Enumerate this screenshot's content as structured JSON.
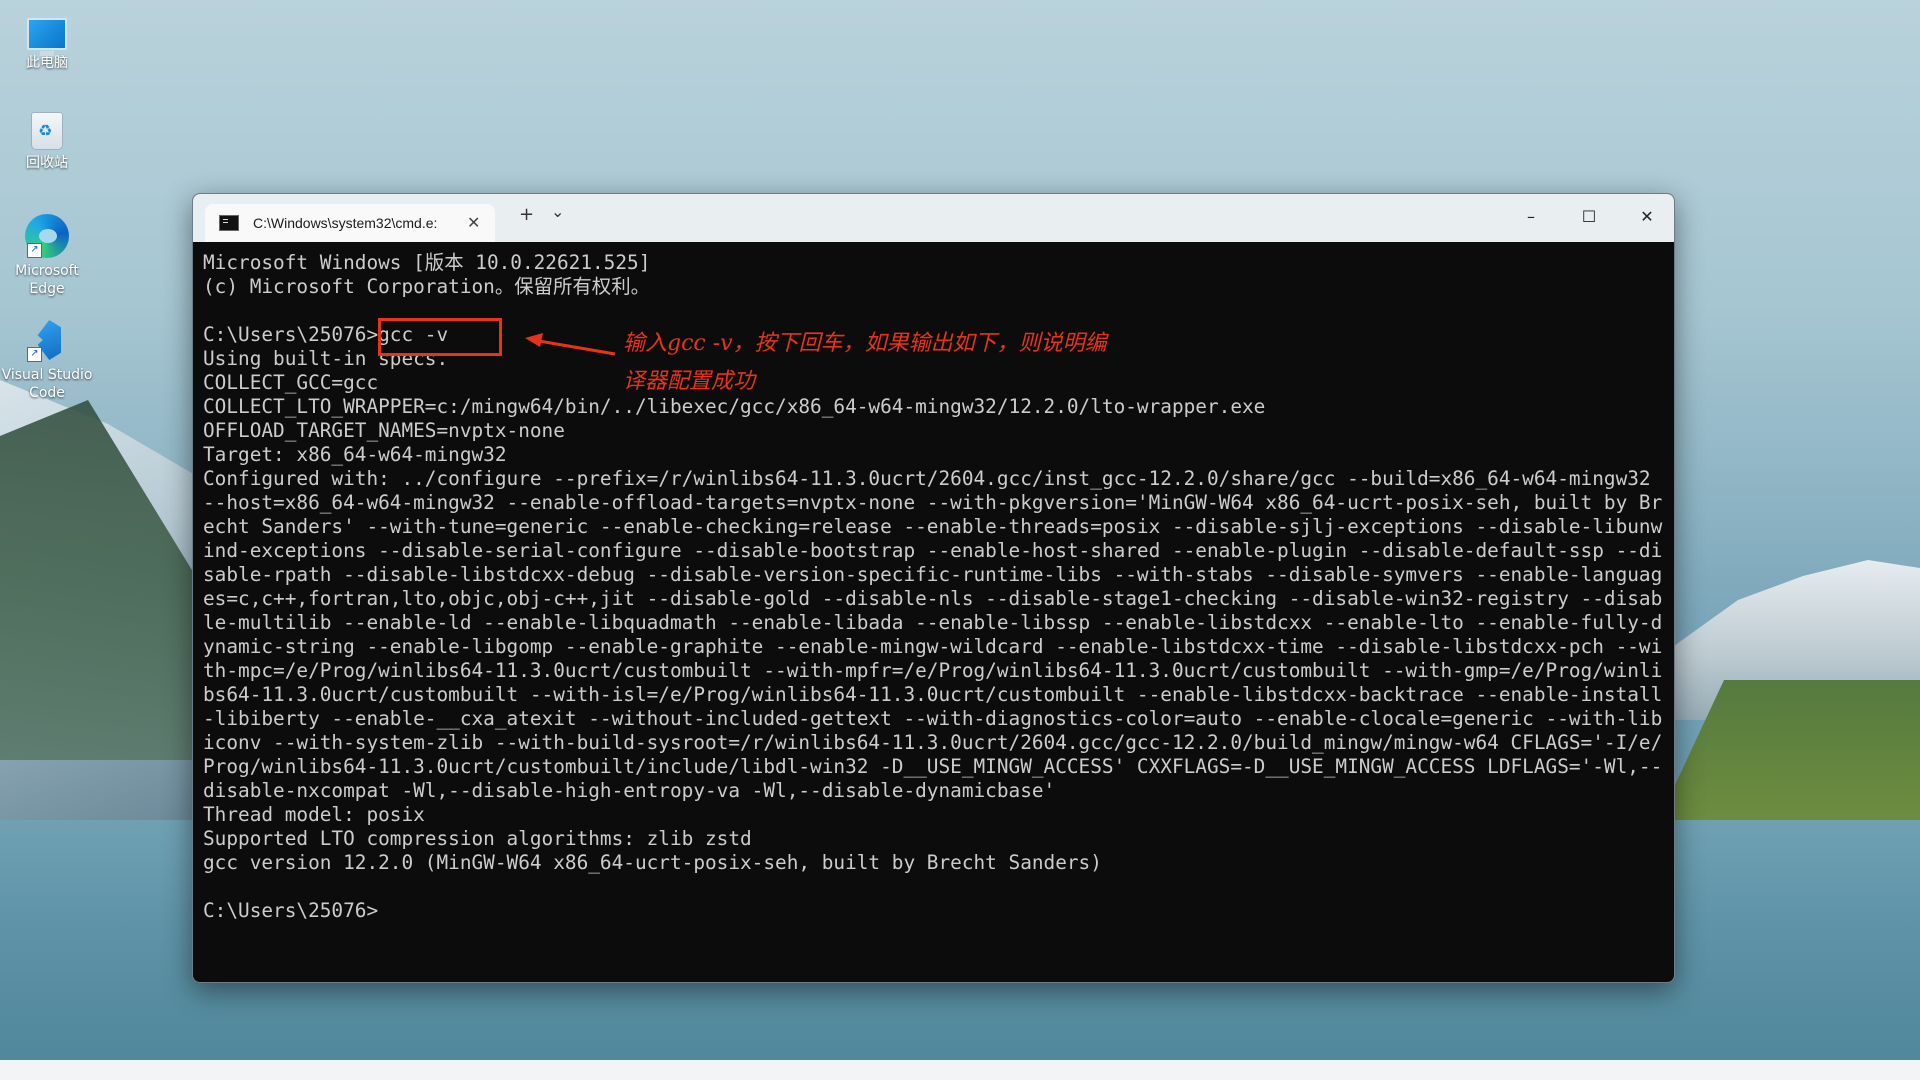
{
  "desktop": {
    "icons": [
      {
        "name": "此电脑",
        "icon": "computer-icon"
      },
      {
        "name": "回收站",
        "icon": "recycle-bin-icon"
      },
      {
        "name": "Microsoft Edge",
        "icon": "edge-icon"
      },
      {
        "name": "Visual Studio Code",
        "icon": "vscode-icon"
      }
    ]
  },
  "window": {
    "tab_title": "C:\\Windows\\system32\\cmd.e:",
    "tab_icon": "cmd-icon",
    "new_tab": "+",
    "dropdown": "⌄",
    "controls": {
      "minimize": "–",
      "maximize": "☐",
      "close": "✕"
    }
  },
  "terminal": {
    "lines": [
      "Microsoft Windows [版本 10.0.22621.525]",
      "(c) Microsoft Corporation。保留所有权利。",
      "",
      "C:\\Users\\25076>gcc -v",
      "Using built-in specs.",
      "COLLECT_GCC=gcc",
      "COLLECT_LTO_WRAPPER=c:/mingw64/bin/../libexec/gcc/x86_64-w64-mingw32/12.2.0/lto-wrapper.exe",
      "OFFLOAD_TARGET_NAMES=nvptx-none",
      "Target: x86_64-w64-mingw32",
      "Configured with: ../configure --prefix=/r/winlibs64-11.3.0ucrt/2604.gcc/inst_gcc-12.2.0/share/gcc --build=x86_64-w64-mingw32 --host=x86_64-w64-mingw32 --enable-offload-targets=nvptx-none --with-pkgversion='MinGW-W64 x86_64-ucrt-posix-seh, built by Brecht Sanders' --with-tune=generic --enable-checking=release --enable-threads=posix --disable-sjlj-exceptions --disable-libunwind-exceptions --disable-serial-configure --disable-bootstrap --enable-host-shared --enable-plugin --disable-default-ssp --disable-rpath --disable-libstdcxx-debug --disable-version-specific-runtime-libs --with-stabs --disable-symvers --enable-languages=c,c++,fortran,lto,objc,obj-c++,jit --disable-gold --disable-nls --disable-stage1-checking --disable-win32-registry --disable-multilib --enable-ld --enable-libquadmath --enable-libada --enable-libssp --enable-libstdcxx --enable-lto --enable-fully-dynamic-string --enable-libgomp --enable-graphite --enable-mingw-wildcard --enable-libstdcxx-time --disable-libstdcxx-pch --with-mpc=/e/Prog/winlibs64-11.3.0ucrt/custombuilt --with-mpfr=/e/Prog/winlibs64-11.3.0ucrt/custombuilt --with-gmp=/e/Prog/winlibs64-11.3.0ucrt/custombuilt --with-isl=/e/Prog/winlibs64-11.3.0ucrt/custombuilt --enable-libstdcxx-backtrace --enable-install-libiberty --enable-__cxa_atexit --without-included-gettext --with-diagnostics-color=auto --enable-clocale=generic --with-libiconv --with-system-zlib --with-build-sysroot=/r/winlibs64-11.3.0ucrt/2604.gcc/gcc-12.2.0/build_mingw/mingw-w64 CFLAGS='-I/e/Prog/winlibs64-11.3.0ucrt/custombuilt/include/libdl-win32 -D__USE_MINGW_ACCESS' CXXFLAGS=-D__USE_MINGW_ACCESS LDFLAGS='-Wl,--disable-nxcompat -Wl,--disable-high-entropy-va -Wl,--disable-dynamicbase'",
      "Thread model: posix",
      "Supported LTO compression algorithms: zlib zstd",
      "gcc version 12.2.0 (MinGW-W64 x86_64-ucrt-posix-seh, built by Brecht Sanders)",
      "",
      "C:\\Users\\25076>"
    ]
  },
  "annotation": {
    "line1": "输入gcc -v，按下回车，如果输出如下，则说明编",
    "line2": "译器配置成功",
    "color": "#e8331c"
  }
}
